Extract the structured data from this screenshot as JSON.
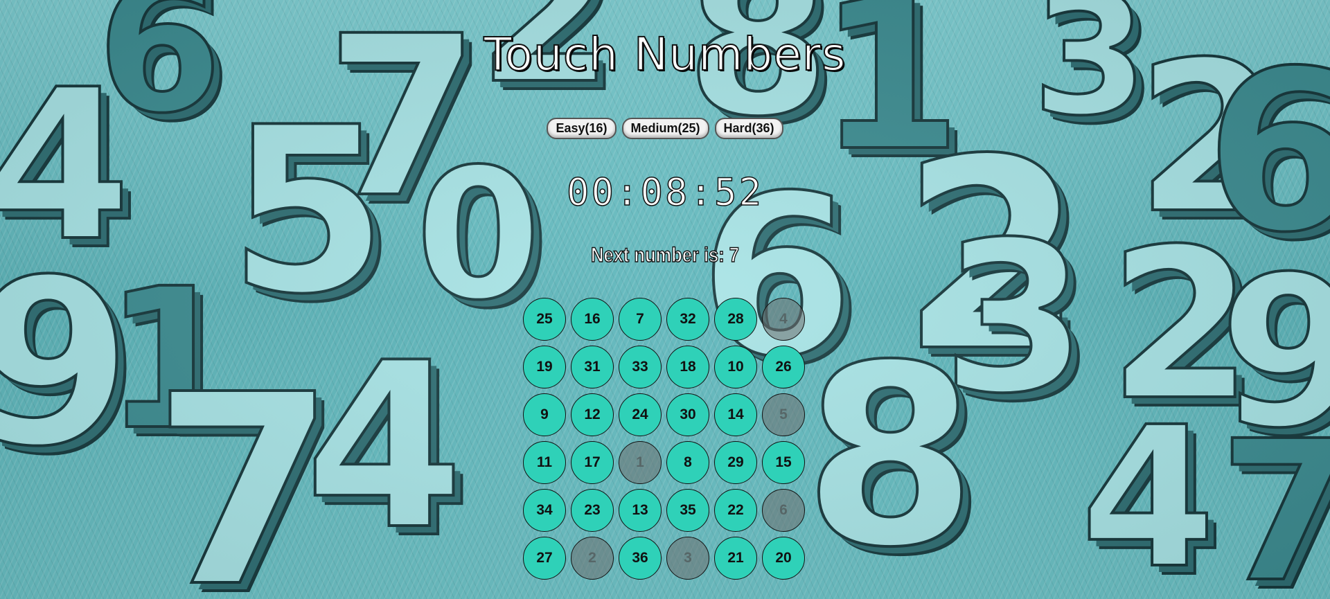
{
  "app": {
    "title": "Touch Numbers"
  },
  "levels": [
    {
      "label": "Easy(16)"
    },
    {
      "label": "Medium(25)"
    },
    {
      "label": "Hard(36)"
    }
  ],
  "timer": "00:08:52",
  "next": {
    "prefix": "Next number is: ",
    "value": "7"
  },
  "board": {
    "cells": [
      {
        "number": "25",
        "done": false
      },
      {
        "number": "16",
        "done": false
      },
      {
        "number": "7",
        "done": false
      },
      {
        "number": "32",
        "done": false
      },
      {
        "number": "28",
        "done": false
      },
      {
        "number": "4",
        "done": true
      },
      {
        "number": "19",
        "done": false
      },
      {
        "number": "31",
        "done": false
      },
      {
        "number": "33",
        "done": false
      },
      {
        "number": "18",
        "done": false
      },
      {
        "number": "10",
        "done": false
      },
      {
        "number": "26",
        "done": false
      },
      {
        "number": "9",
        "done": false
      },
      {
        "number": "12",
        "done": false
      },
      {
        "number": "24",
        "done": false
      },
      {
        "number": "30",
        "done": false
      },
      {
        "number": "14",
        "done": false
      },
      {
        "number": "5",
        "done": true
      },
      {
        "number": "11",
        "done": false
      },
      {
        "number": "17",
        "done": false
      },
      {
        "number": "1",
        "done": true
      },
      {
        "number": "8",
        "done": false
      },
      {
        "number": "29",
        "done": false
      },
      {
        "number": "15",
        "done": false
      },
      {
        "number": "34",
        "done": false
      },
      {
        "number": "23",
        "done": false
      },
      {
        "number": "13",
        "done": false
      },
      {
        "number": "35",
        "done": false
      },
      {
        "number": "22",
        "done": false
      },
      {
        "number": "6",
        "done": true
      },
      {
        "number": "27",
        "done": false
      },
      {
        "number": "2",
        "done": true
      },
      {
        "number": "36",
        "done": false
      },
      {
        "number": "3",
        "done": true
      },
      {
        "number": "21",
        "done": false
      },
      {
        "number": "20",
        "done": false
      }
    ]
  },
  "colors": {
    "active_cell": "#2fd1b8",
    "done_cell": "#6e6e6e",
    "background": "#5fb9bd"
  }
}
